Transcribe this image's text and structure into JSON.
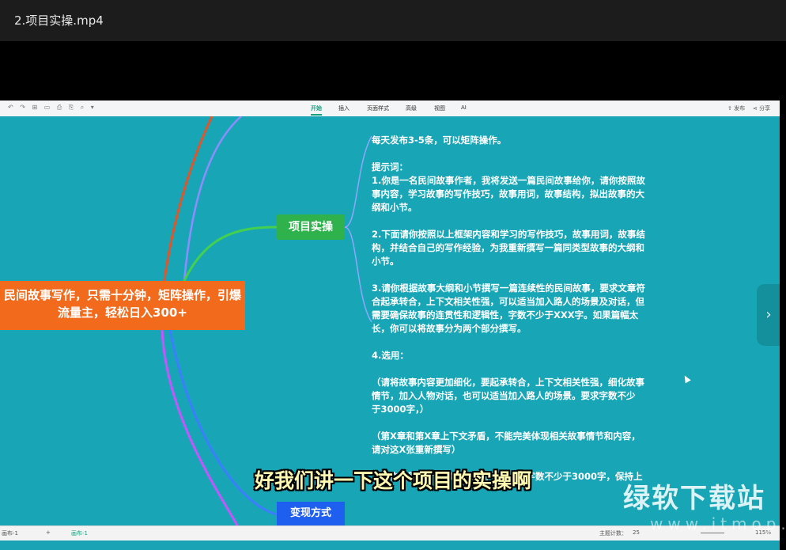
{
  "window": {
    "title": "2.项目实操.mp4"
  },
  "toolbar": {
    "quick_icons": "↶ ↷ ⊞ ▭ ⎙ ⎘ ⌕ ▾",
    "tabs": [
      "开始",
      "插入",
      "页面样式",
      "高级",
      "视图",
      "AI"
    ],
    "active_tab": "开始",
    "publish_label": "发布",
    "share_label": "分享"
  },
  "mindmap": {
    "central_topic_line1": "民间故事写作，只需十分钟，矩阵操作，引爆",
    "central_topic_line2": "流量主，轻松日入300+",
    "node_practice": "项目实操",
    "node_monetize": "变现方式",
    "notes": [
      "每天发布3-5条，可以矩阵操作。",
      "",
      "提示词：",
      "1.你是一名民间故事作者，我将发送一篇民间故事给你，请你按照故",
      "事内容，学习故事的写作技巧，故事用词，故事结构，拟出故事的大",
      "纲和小节。",
      "",
      "2.下面请你按照以上框架内容和学习的写作技巧，故事用词，故事结",
      "构，并结合自己的写作经验，为我重新撰写一篇同类型故事的大纲和",
      "小节。",
      "",
      "3.请你根据故事大纲和小节撰写一篇连续性的民间故事，要求文章符",
      "合起承转合，上下文相关性强，可以适当加入路人的场景及对话，但",
      "需要确保故事的连贯性和逻辑性，字数不少于XXX字。如果篇幅太",
      "长，你可以将故事分为两个部分撰写。",
      "",
      "4.选用：",
      "",
      "（请将故事内容更加细化，要起承转合，上下文相关性强，细化故事",
      "情节，加入人物对话，也可以适当加入路人的场景。要求字数不少",
      "于3000字，）",
      "",
      "（第X章和第X章上下文矛盾，不能完美体现相关故事情节和内容，",
      "请对这X张重新撰写）",
      "",
      "（请你按照这个故事线继续写下去，总字数不少于3000字，保持上"
    ]
  },
  "statusbar": {
    "sheet_left": "画布-1",
    "add_sheet": "+",
    "sheet_tab": "画布-1",
    "topic_count_label": "主题计数：",
    "topic_count": "25",
    "zoom": "115%"
  },
  "subtitle": "好我们讲一下这个项目的实操啊",
  "watermark": {
    "brand": "绿软下载站",
    "domain": "www.itmop.com"
  },
  "colors": {
    "canvas_bg": "#18a6b6",
    "central_node": "#f26b1d",
    "practice_node": "#2fb24c",
    "monetize_node": "#1f5ff0"
  }
}
